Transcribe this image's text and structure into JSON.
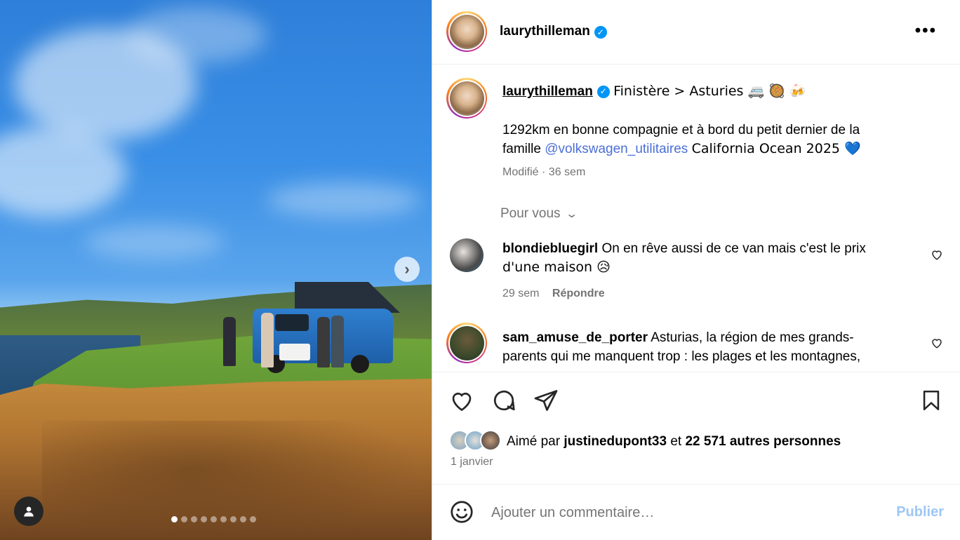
{
  "post": {
    "username": "laurythilleman",
    "caption_title": "Finistère > Asturies 🚐 🥘 🍻",
    "caption_body_1": "1292km en bonne compagnie et à bord du petit dernier de la",
    "caption_body_2_start": "famille",
    "caption_mention": "@volkswagen_utilitaires",
    "caption_body_2_end": "California Ocean 2025 💙",
    "caption_meta": "Modifié · 36 sem",
    "filter_label": "Pour vous"
  },
  "comments": [
    {
      "username": "blondiebluegirl",
      "text_1": "On en rêve aussi de ce van mais c'est le prix",
      "text_2": "d'une maison 😥",
      "time": "29 sem",
      "reply": "Répondre"
    },
    {
      "username": "sam_amuse_de_porter",
      "text_1": "Asturias, la région de mes grands-",
      "text_2": "parents qui me manquent trop : les plages et les montagnes,"
    }
  ],
  "likes": {
    "prefix": "Aimé par",
    "user": "justinedupont33",
    "middle": "et",
    "others": "22 571 autres personnes",
    "date": "1 janvier"
  },
  "composer": {
    "placeholder": "Ajouter un commentaire…",
    "publish": "Publier"
  },
  "carousel": {
    "total_slides": 9,
    "current_slide": 1
  },
  "colors": {
    "accent": "#0095f6",
    "publish_disabled": "#9dc7f5",
    "muted": "#737373",
    "mention": "#4b6fd6"
  }
}
